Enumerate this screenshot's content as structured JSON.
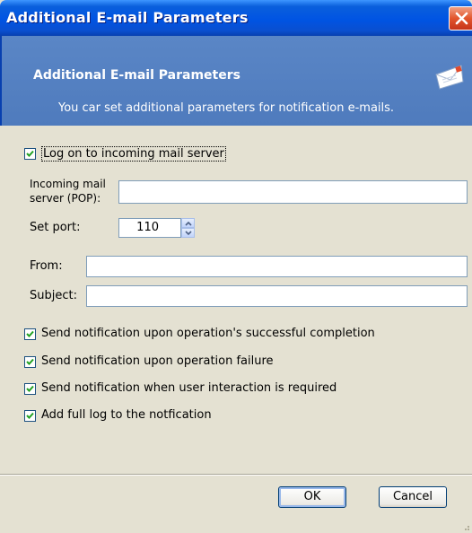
{
  "window": {
    "title": "Additional E-mail Parameters",
    "close_icon": "close-icon"
  },
  "header": {
    "title": "Additional E-mail Parameters",
    "subtitle": "You car set additional parameters for notification e-mails.",
    "icon": "mail-icon"
  },
  "logon": {
    "label": "Log on to incoming mail server",
    "checked": true
  },
  "incoming": {
    "label_line1": "Incoming mail",
    "label_line2": "server (POP):",
    "value": ""
  },
  "port": {
    "label": "Set port:",
    "value": "110"
  },
  "from": {
    "label": "From:",
    "value": ""
  },
  "subject": {
    "label": "Subject:",
    "value": ""
  },
  "notifications": [
    {
      "label": "Send notification upon operation's successful completion",
      "checked": true
    },
    {
      "label": "Send notification upon operation failure",
      "checked": true
    },
    {
      "label": "Send notification when user interaction is required",
      "checked": true
    },
    {
      "label": "Add full log to the notfication",
      "checked": true
    }
  ],
  "buttons": {
    "ok": "OK",
    "cancel": "Cancel"
  },
  "colors": {
    "titlebar": "#0054e3",
    "header_panel": "#4f7bbd",
    "dialog_bg": "#e4e1d2",
    "checkmark": "#21a121"
  }
}
